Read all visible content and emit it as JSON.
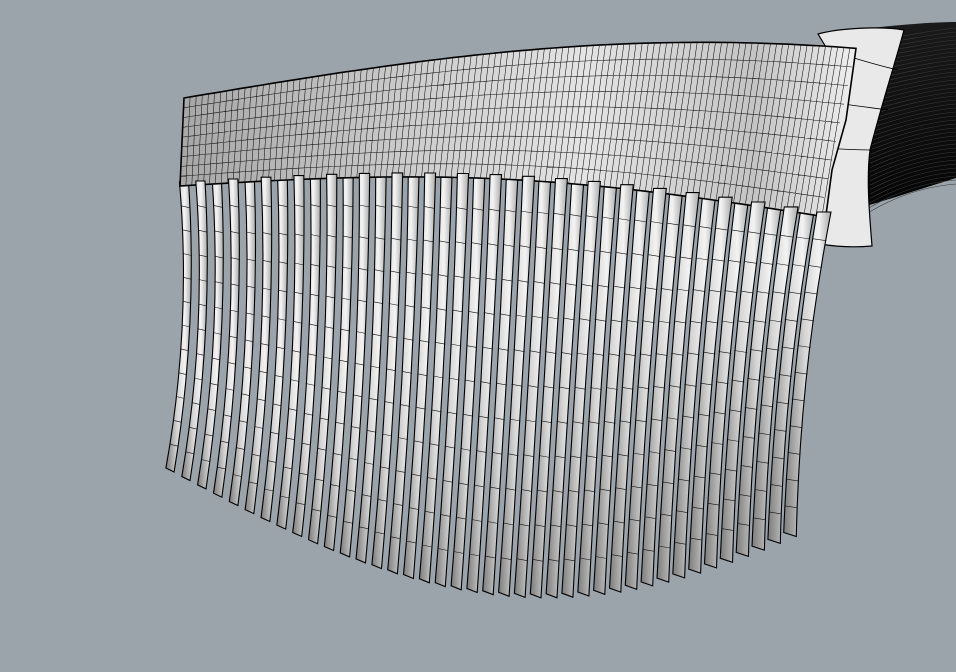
{
  "viewport": {
    "background": "#9ba3ab",
    "display_mode": "shaded-with-wireframe"
  },
  "model": {
    "surface_color": "#d8d8d8",
    "highlight_color": "#f4f4f4",
    "shadow_color": "#8e8e8e",
    "edge_color": "#000000",
    "fringe_strip_count": 40,
    "band_column_count": 110
  }
}
